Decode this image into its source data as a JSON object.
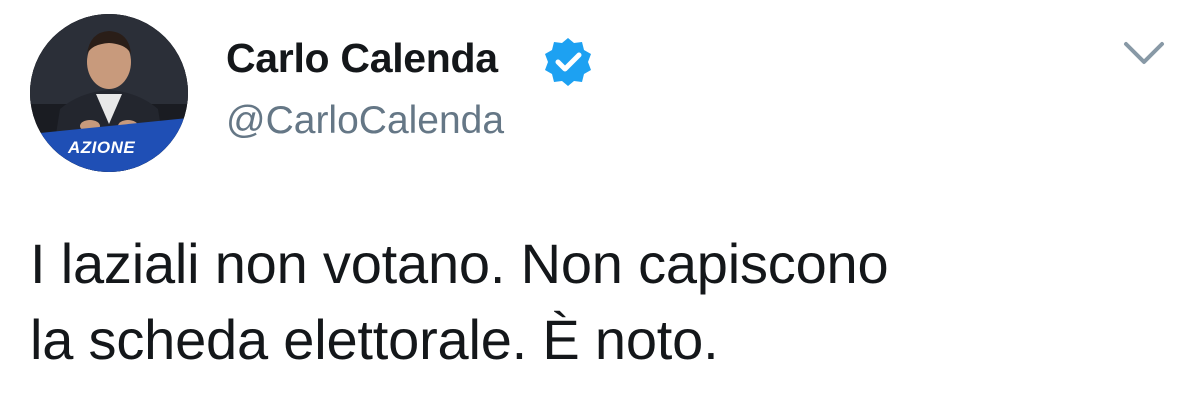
{
  "tweet": {
    "author": {
      "display_name": "Carlo Calenda",
      "handle": "@CarloCalenda",
      "verified": true,
      "avatar_badge": "AZIONE"
    },
    "text_lines": [
      "I laziali non votano. Non capiscono",
      "la scheda elettorale. È noto."
    ],
    "menu_icon": "chevron-down-icon"
  },
  "colors": {
    "name": "#14171a",
    "handle": "#657786",
    "verified_badge": "#1da1f2",
    "avatar_bg": "#1a1c22",
    "avatar_badge_bg": "#1f4fb5"
  }
}
